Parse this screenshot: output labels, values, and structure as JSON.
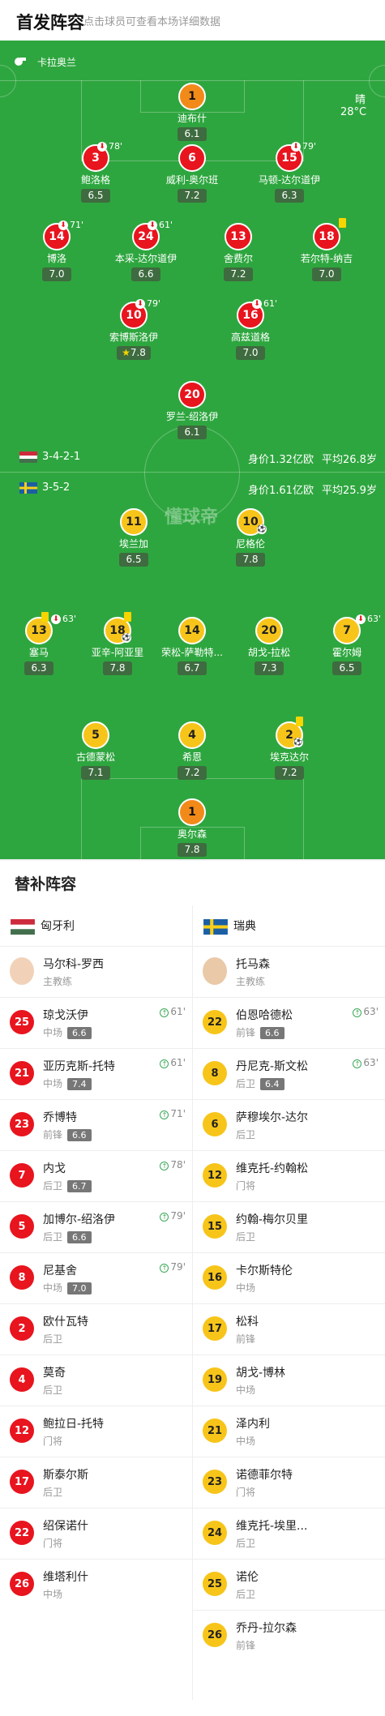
{
  "header": {
    "title": "首发阵容",
    "subtitle": "点击球员可查看本场详细数据"
  },
  "pitch": {
    "stadium": "卡拉奥兰",
    "weather": "晴",
    "temp": "28°C",
    "watermark": "懂球帝"
  },
  "home": {
    "formation": "3-4-2-1",
    "value": "身价1.32亿欧",
    "age": "平均26.8岁"
  },
  "away": {
    "formation": "3-5-2",
    "value": "身价1.61亿欧",
    "age": "平均25.9岁"
  },
  "subs": {
    "title": "替补阵容",
    "home_team": "匈牙利",
    "away_team": "瑞典",
    "home_coach": {
      "name": "马尔科-罗西",
      "role": "主教练"
    },
    "away_coach": {
      "name": "托马森",
      "role": "主教练"
    },
    "home_list": [
      {
        "num": "25",
        "name": "琼戈沃伊",
        "pos": "中场",
        "rating": "6.6",
        "min": "61'"
      },
      {
        "num": "21",
        "name": "亚历克斯-托特",
        "pos": "中场",
        "rating": "7.4",
        "min": "61'"
      },
      {
        "num": "23",
        "name": "乔博特",
        "pos": "前锋",
        "rating": "6.6",
        "min": "71'"
      },
      {
        "num": "7",
        "name": "内戈",
        "pos": "后卫",
        "rating": "6.7",
        "min": "78'"
      },
      {
        "num": "5",
        "name": "加博尔-绍洛伊",
        "pos": "后卫",
        "rating": "6.6",
        "min": "79'"
      },
      {
        "num": "8",
        "name": "尼基舍",
        "pos": "中场",
        "rating": "7.0",
        "min": "79'"
      },
      {
        "num": "2",
        "name": "欧什瓦特",
        "pos": "后卫",
        "rating": "",
        "min": ""
      },
      {
        "num": "4",
        "name": "莫奇",
        "pos": "后卫",
        "rating": "",
        "min": ""
      },
      {
        "num": "12",
        "name": "鲍拉日-托特",
        "pos": "门将",
        "rating": "",
        "min": ""
      },
      {
        "num": "17",
        "name": "斯泰尔斯",
        "pos": "后卫",
        "rating": "",
        "min": ""
      },
      {
        "num": "22",
        "name": "绍保诺什",
        "pos": "门将",
        "rating": "",
        "min": ""
      },
      {
        "num": "26",
        "name": "维塔利什",
        "pos": "中场",
        "rating": "",
        "min": ""
      }
    ],
    "away_list": [
      {
        "num": "22",
        "name": "伯恩哈德松",
        "pos": "前锋",
        "rating": "6.6",
        "min": "63'"
      },
      {
        "num": "8",
        "name": "丹尼克-斯文松",
        "pos": "后卫",
        "rating": "6.4",
        "min": "63'"
      },
      {
        "num": "6",
        "name": "萨穆埃尔-达尔",
        "pos": "后卫",
        "rating": "",
        "min": ""
      },
      {
        "num": "12",
        "name": "维克托-约翰松",
        "pos": "门将",
        "rating": "",
        "min": ""
      },
      {
        "num": "15",
        "name": "约翰-梅尔贝里",
        "pos": "后卫",
        "rating": "",
        "min": ""
      },
      {
        "num": "16",
        "name": "卡尔斯特伦",
        "pos": "中场",
        "rating": "",
        "min": ""
      },
      {
        "num": "17",
        "name": "松科",
        "pos": "前锋",
        "rating": "",
        "min": ""
      },
      {
        "num": "19",
        "name": "胡戈-博林",
        "pos": "中场",
        "rating": "",
        "min": ""
      },
      {
        "num": "21",
        "name": "泽内利",
        "pos": "中场",
        "rating": "",
        "min": ""
      },
      {
        "num": "23",
        "name": "诺德菲尔特",
        "pos": "门将",
        "rating": "",
        "min": ""
      },
      {
        "num": "24",
        "name": "维克托-埃里...",
        "pos": "后卫",
        "rating": "",
        "min": ""
      },
      {
        "num": "25",
        "name": "诺伦",
        "pos": "后卫",
        "rating": "",
        "min": ""
      },
      {
        "num": "26",
        "name": "乔丹-拉尔森",
        "pos": "前锋",
        "rating": "",
        "min": ""
      }
    ]
  },
  "players": [
    {
      "id": "h1",
      "num": "1",
      "name": "迪布什",
      "rating": "6.1"
    },
    {
      "id": "h3",
      "num": "3",
      "name": "鲍洛格",
      "rating": "6.5",
      "sub": "78'"
    },
    {
      "id": "h6",
      "num": "6",
      "name": "威利-奥尔班",
      "rating": "7.2"
    },
    {
      "id": "h15",
      "num": "15",
      "name": "马顿-达尔道伊",
      "rating": "6.3",
      "sub": "79'"
    },
    {
      "id": "h14",
      "num": "14",
      "name": "博洛",
      "rating": "7.0",
      "sub": "71'"
    },
    {
      "id": "h24",
      "num": "24",
      "name": "本采-达尔道伊",
      "rating": "6.6",
      "sub": "61'"
    },
    {
      "id": "h13",
      "num": "13",
      "name": "舍费尔",
      "rating": "7.2"
    },
    {
      "id": "h18",
      "num": "18",
      "name": "若尔特-纳吉",
      "rating": "7.0"
    },
    {
      "id": "h10",
      "num": "10",
      "name": "索博斯洛伊",
      "rating": "7.8",
      "sub": "79'"
    },
    {
      "id": "h16",
      "num": "16",
      "name": "高兹道格",
      "rating": "7.0",
      "sub": "61'"
    },
    {
      "id": "h20",
      "num": "20",
      "name": "罗兰-绍洛伊",
      "rating": "6.1"
    },
    {
      "id": "a11",
      "num": "11",
      "name": "埃兰加",
      "rating": "6.5"
    },
    {
      "id": "a10",
      "num": "10",
      "name": "尼格伦",
      "rating": "7.8"
    },
    {
      "id": "a13",
      "num": "13",
      "name": "塞马",
      "rating": "6.3",
      "sub": "63'"
    },
    {
      "id": "a18",
      "num": "18",
      "name": "亚辛-阿亚里",
      "rating": "7.8"
    },
    {
      "id": "a14",
      "num": "14",
      "name": "荣松-萨勒特...",
      "rating": "6.7"
    },
    {
      "id": "a20",
      "num": "20",
      "name": "胡戈-拉松",
      "rating": "7.3"
    },
    {
      "id": "a7",
      "num": "7",
      "name": "霍尔姆",
      "rating": "6.5",
      "sub": "63'"
    },
    {
      "id": "a5",
      "num": "5",
      "name": "古德蒙松",
      "rating": "7.1"
    },
    {
      "id": "a4",
      "num": "4",
      "name": "希恩",
      "rating": "7.2"
    },
    {
      "id": "a2",
      "num": "2",
      "name": "埃克达尔",
      "rating": "7.2"
    },
    {
      "id": "a1",
      "num": "1",
      "name": "奥尔森",
      "rating": "7.8"
    }
  ]
}
